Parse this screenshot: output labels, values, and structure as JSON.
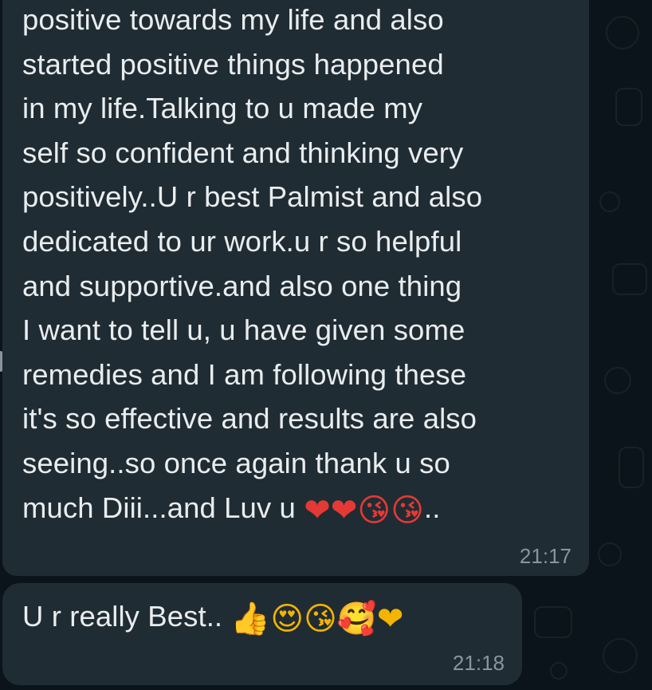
{
  "messages": [
    {
      "text": "positive towards my life and also\nstarted positive things happened\nin my life.Talking to u made my\nself so confident and thinking very\npositively..U r best Palmist and also\ndedicated to ur work.u r so helpful\nand supportive.and also one thing\nI want to tell u, u have given some\nremedies and I am following these\nit's so effective and results are also\nseeing..so once again thank u so\nmuch Diii...and  Luv u ",
      "emoji": "❤❤😘😘",
      "tail": "..",
      "time": "21:17"
    },
    {
      "text": "U r really Best.. ",
      "emoji": "👍😍😘🥰❤",
      "time": "21:18"
    }
  ],
  "colors": {
    "background": "#0b141a",
    "bubble": "#202c33",
    "text": "#e9edef",
    "timestamp": "#8696a0"
  }
}
